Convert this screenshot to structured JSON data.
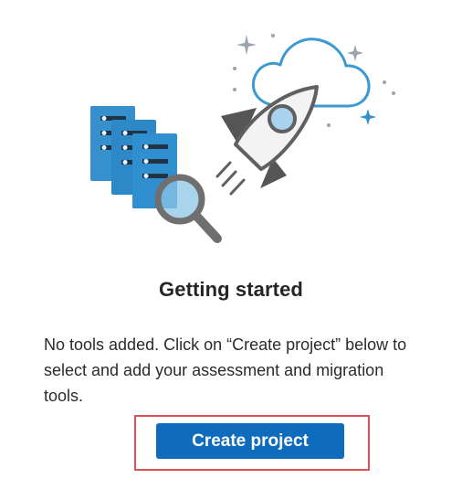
{
  "empty_state": {
    "illustration_icons": [
      "server-stack-icon",
      "magnifier-icon",
      "rocket-icon",
      "cloud-icon",
      "sparkle-icon"
    ],
    "title": "Getting started",
    "description": "No tools added. Click on “Create project” below to select and add your assessment and migration tools.",
    "primary_button_label": "Create project"
  },
  "colors": {
    "button": "#0f6cbd",
    "highlight_border": "#e05157",
    "server_blue": "#2f8fcf",
    "cloud_stroke": "#3d9ad1",
    "rocket_gray": "#606060"
  }
}
